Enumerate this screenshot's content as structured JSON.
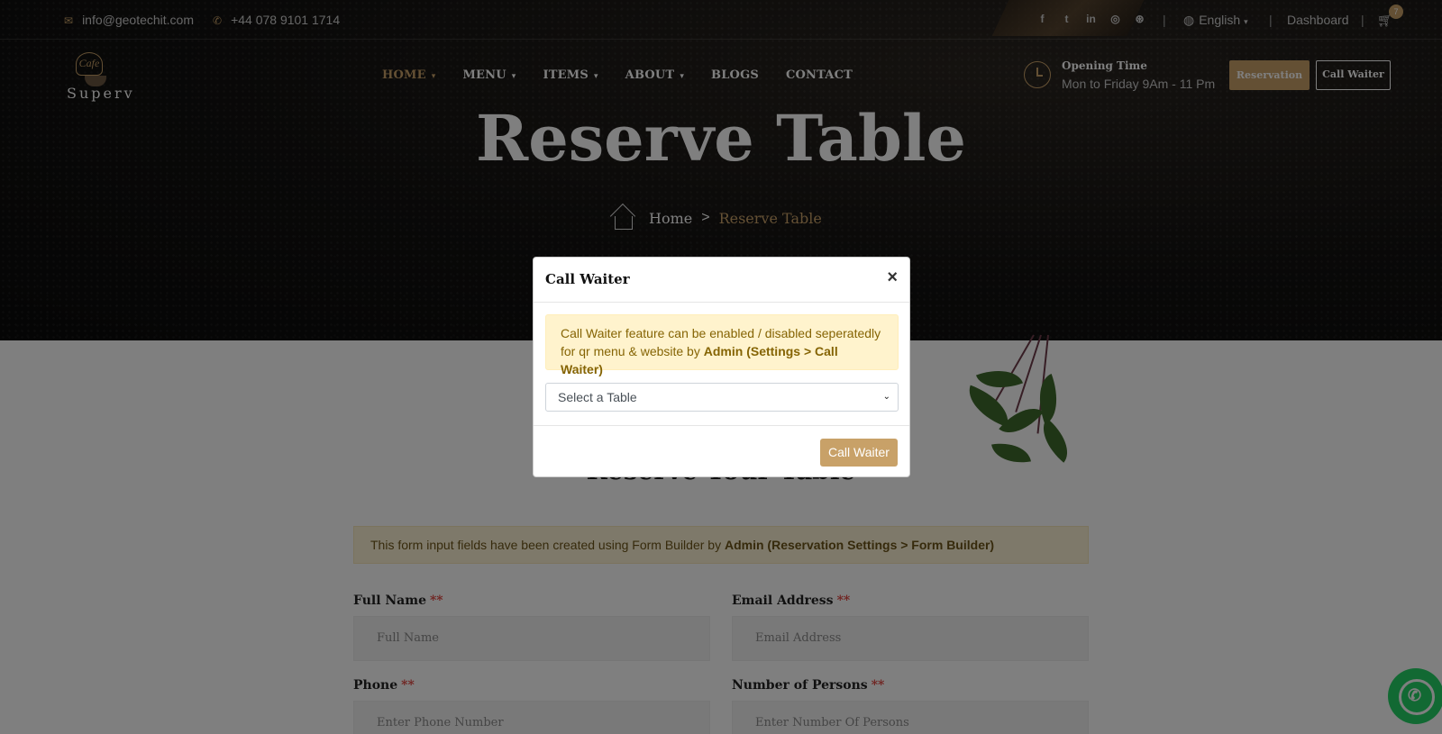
{
  "topbar": {
    "email": "info@geotechit.com",
    "phone": "+44 078 9101 1714",
    "email_icon": "envelope-icon",
    "phone_icon": "phone-icon",
    "social_icons": [
      "facebook-icon",
      "twitter-icon",
      "linkedin-icon",
      "instagram-icon",
      "dribbble-icon"
    ],
    "social_glyphs": [
      "f",
      "t",
      "in",
      "◎",
      "⊛"
    ],
    "language": "English",
    "dashboard": "Dashboard",
    "cart_count": "7"
  },
  "logo": {
    "badge": "Cafe",
    "word": "Superv"
  },
  "nav": {
    "items": [
      {
        "label": "HOME",
        "active": true,
        "has_dropdown": true
      },
      {
        "label": "MENU",
        "active": false,
        "has_dropdown": true
      },
      {
        "label": "ITEMS",
        "active": false,
        "has_dropdown": true
      },
      {
        "label": "ABOUT",
        "active": false,
        "has_dropdown": true
      },
      {
        "label": "BLOGS",
        "active": false,
        "has_dropdown": false
      },
      {
        "label": "CONTACT",
        "active": false,
        "has_dropdown": false
      }
    ]
  },
  "header": {
    "opening_title": "Opening Time",
    "opening_hours": "Mon to Friday 9Am - 11 Pm",
    "reservation_button": "Reservation",
    "call_waiter_button": "Call Waiter"
  },
  "hero": {
    "title": "Reserve Table",
    "breadcrumb_home": "Home",
    "breadcrumb_sep": ">",
    "breadcrumb_current": "Reserve Table"
  },
  "content": {
    "section_title": "Reserve Your Table",
    "info_text": "This form input fields have been created using Form Builder by ",
    "info_bold": "Admin (Reservation Settings > Form Builder)",
    "fields": [
      {
        "label": "Full Name",
        "required": "**",
        "placeholder": "Full Name"
      },
      {
        "label": "Email Address",
        "required": "**",
        "placeholder": "Email Address"
      },
      {
        "label": "Phone",
        "required": "**",
        "placeholder": "Enter Phone Number"
      },
      {
        "label": "Number of Persons",
        "required": "**",
        "placeholder": "Enter Number Of Persons"
      }
    ]
  },
  "modal": {
    "title": "Call Waiter",
    "close": "×",
    "alert_text": "Call Waiter feature can be enabled / disabled seperatedly for qr menu & website by ",
    "alert_bold": "Admin (Settings > Call Waiter)",
    "select_value": "Select a Table",
    "submit": "Call Waiter"
  },
  "colors": {
    "accent": "#c8a168",
    "hero_bg": "#121110",
    "alert_bg": "#fff3cd",
    "alert_text": "#856404",
    "whatsapp": "#25d366"
  }
}
